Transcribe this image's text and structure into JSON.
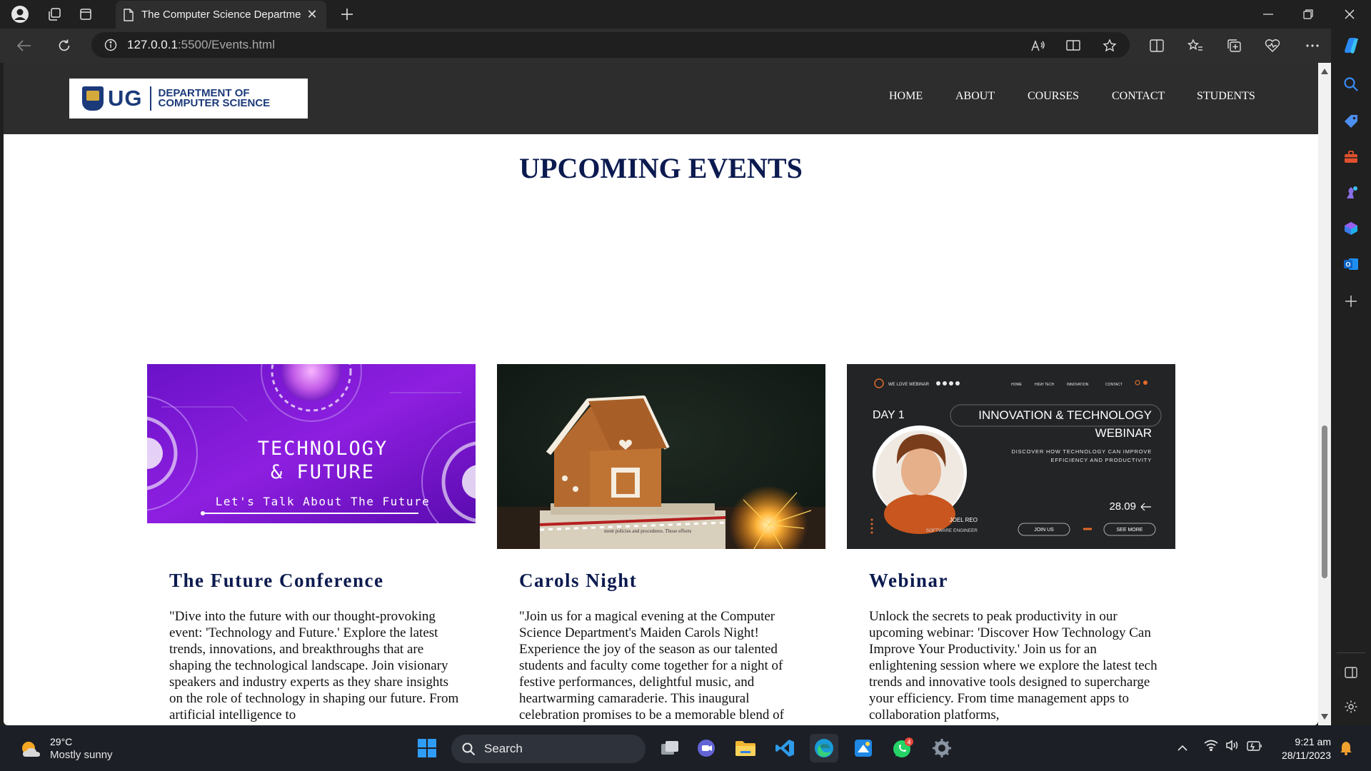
{
  "browser": {
    "tab_title": "The Computer Science Departme",
    "url_host": "127.0.0.1",
    "url_path": ":5500/Events.html"
  },
  "site": {
    "logo_text": "UG",
    "logo_dept_line1": "DEPARTMENT OF",
    "logo_dept_line2": "COMPUTER SCIENCE",
    "nav": [
      "HOME",
      "ABOUT",
      "COURSES",
      "CONTACT",
      "STUDENTS"
    ],
    "heading": "UPCOMING EVENTS"
  },
  "events": [
    {
      "title": "The Future Conference",
      "body": "\"Dive into the future with our thought-provoking event: 'Technology and Future.' Explore the latest trends, innovations, and breakthroughs that are shaping the technological landscape. Join visionary speakers and industry experts as they share insights on the role of technology in shaping our future. From artificial intelligence to",
      "image": {
        "line1": "TECHNOLOGY",
        "line2": "& FUTURE",
        "tagline": "Let's Talk About The Future"
      }
    },
    {
      "title": "Carols Night",
      "body": "\"Join us for a magical evening at the Computer Science Department's Maiden Carols Night! Experience the joy of the season as our talented students and faculty come together for a night of festive performances, delightful music, and heartwarming camaraderie. This inaugural celebration promises to be a memorable blend of",
      "image": {
        "note": "ment policies and procedures. Those efforts"
      }
    },
    {
      "title": "Webinar",
      "body": "Unlock the secrets to peak productivity in our upcoming webinar: 'Discover How Technology Can Improve Your Productivity.' Join us for an enlightening session where we explore the latest tech trends and innovative tools designed to supercharge your efficiency. From time management apps to collaboration platforms,",
      "image": {
        "brand": "WE LOVE WEBINAR",
        "nav": [
          "HOME",
          "HIGH TECH",
          "INNOVATION",
          "CONTACT"
        ],
        "day": "DAY 1",
        "title_line1": "INNOVATION & TECHNOLOGY",
        "title_line2": "WEBINAR",
        "sub_line1": "DISCOVER HOW TECHNOLOGY CAN IMPROVE",
        "sub_line2": "EFFICIENCY AND PRODUCTIVITY",
        "date": "28.09",
        "speaker": "JOEL REO",
        "role": "SOFTWARE ENGINEER",
        "join": "JOIN US",
        "more": "SEE MORE"
      }
    }
  ],
  "taskbar": {
    "weather_temp": "29°C",
    "weather_cond": "Mostly sunny",
    "search_label": "Search",
    "whatsapp_badge": "4",
    "time": "9:21 am",
    "date": "28/11/2023"
  }
}
